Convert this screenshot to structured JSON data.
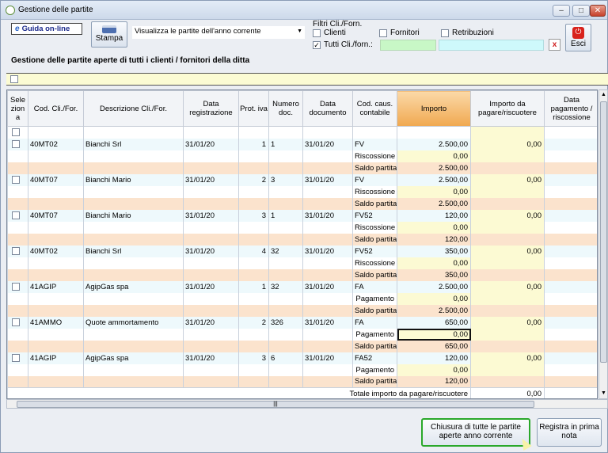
{
  "window": {
    "title": "Gestione delle partite"
  },
  "toolbar": {
    "guida_label": "Guida on-line",
    "stampa_label": "Stampa",
    "visualizza_value": "Visualizza le partite dell'anno corrente",
    "filtri_title": "Filtri Cli./Forn.",
    "clienti_label": "Clienti",
    "fornitori_label": "Fornitori",
    "retribuzioni_label": "Retribuzioni",
    "tutti_label": "Tutti Cli./forn.:",
    "clear_label": "x",
    "esci_label": "Esci"
  },
  "heading": "Gestione delle partite aperte di tutti i clienti / fornitori della ditta",
  "columns": [
    "Sele zion a",
    "Cod. Cli./For.",
    "Descrizione Cli./For.",
    "Data registrazione",
    "Prot. iva",
    "Numero doc.",
    "Data documento",
    "Cod. caus. contabile",
    "Importo",
    "Importo da pagare/riscuotere",
    "Data pagamento / riscossione"
  ],
  "entries": [
    {
      "cod": "40MT02",
      "desc": "Bianchi Srl",
      "data_reg": "31/01/20",
      "prot": "1",
      "num": "1",
      "data_doc": "31/01/20",
      "caus": "FV",
      "importo": "2.500,00",
      "da_pagare": "0,00",
      "sub_label": "Riscossione",
      "sub_value": "0,00",
      "saldo_label": "Saldo partita",
      "saldo_value": "2.500,00"
    },
    {
      "cod": "40MT07",
      "desc": "Bianchi Mario",
      "data_reg": "31/01/20",
      "prot": "2",
      "num": "3",
      "data_doc": "31/01/20",
      "caus": "FV",
      "importo": "2.500,00",
      "da_pagare": "0,00",
      "sub_label": "Riscossione",
      "sub_value": "0,00",
      "saldo_label": "Saldo partita",
      "saldo_value": "2.500,00"
    },
    {
      "cod": "40MT07",
      "desc": "Bianchi Mario",
      "data_reg": "31/01/20",
      "prot": "3",
      "num": "1",
      "data_doc": "31/01/20",
      "caus": "FV52",
      "importo": "120,00",
      "da_pagare": "0,00",
      "sub_label": "Riscossione",
      "sub_value": "0,00",
      "saldo_label": "Saldo partita",
      "saldo_value": "120,00"
    },
    {
      "cod": "40MT02",
      "desc": "Bianchi Srl",
      "data_reg": "31/01/20",
      "prot": "4",
      "num": "32",
      "data_doc": "31/01/20",
      "caus": "FV52",
      "importo": "350,00",
      "da_pagare": "0,00",
      "sub_label": "Riscossione",
      "sub_value": "0,00",
      "saldo_label": "Saldo partita",
      "saldo_value": "350,00"
    },
    {
      "cod": "41AGIP",
      "desc": "AgipGas spa",
      "data_reg": "31/01/20",
      "prot": "1",
      "num": "32",
      "data_doc": "31/01/20",
      "caus": "FA",
      "importo": "2.500,00",
      "da_pagare": "0,00",
      "sub_label": "Pagamento",
      "sub_value": "0,00",
      "saldo_label": "Saldo partita",
      "saldo_value": "2.500,00"
    },
    {
      "cod": "41AMMO",
      "desc": "Quote ammortamento",
      "data_reg": "31/01/20",
      "prot": "2",
      "num": "326",
      "data_doc": "31/01/20",
      "caus": "FA",
      "importo": "650,00",
      "da_pagare": "0,00",
      "sub_label": "Pagamento",
      "sub_value": "0,00",
      "saldo_label": "Saldo partita",
      "saldo_value": "650,00"
    },
    {
      "cod": "41AGIP",
      "desc": "AgipGas spa",
      "data_reg": "31/01/20",
      "prot": "3",
      "num": "6",
      "data_doc": "31/01/20",
      "caus": "FA52",
      "importo": "120,00",
      "da_pagare": "0,00",
      "sub_label": "Pagamento",
      "sub_value": "0,00",
      "saldo_label": "Saldo partita",
      "saldo_value": "120,00"
    }
  ],
  "total": {
    "label": "Totale importo da pagare/riscuotere",
    "value": "0,00"
  },
  "buttons": {
    "chiusura_label": "Chiusura di tutte le partite aperte anno corrente",
    "registra_label": "Registra in prima nota"
  },
  "colors": {
    "highlight_header": "#f0a850",
    "saldo_row": "#fbe3cd",
    "main_row": "#eef9fc",
    "input_cell": "#fcfad3",
    "green_border": "#2aa82a"
  }
}
